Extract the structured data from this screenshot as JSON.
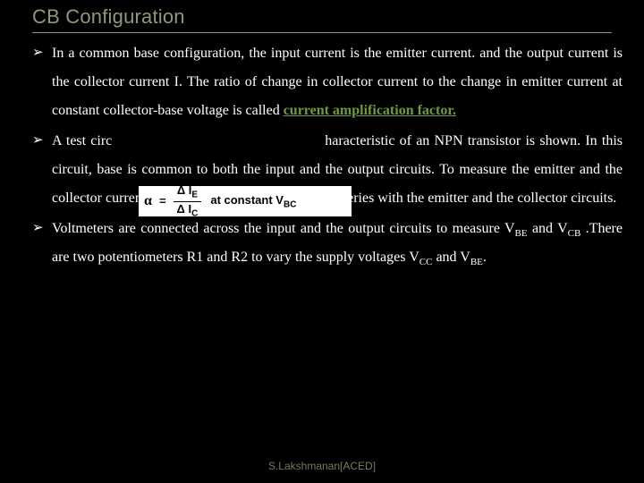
{
  "title": "CB Configuration",
  "bullets": {
    "b1_pre": "In a common base configuration, the input current is the emitter current. and the output current is the collector current I. The ratio of change in collector current to the change in emitter current at constant collector-base voltage is called ",
    "b1_hl": "current amplification factor.",
    "b2_pre": "A test circ",
    "b2_post": "haracteristic of an NPN transistor is shown. In this circuit, base is common to both the input and the output circuits. To measure the emitter and the collector currents mull ammeters are connected in series with the emitter and the collector circuits.",
    "b3_a": "Voltmeters are connected across the input and the output circuits to measure V",
    "b3_sub1": "BE",
    "b3_b": " and V",
    "b3_sub2": "CB",
    "b3_c": " .There are two potentiometers R1 and R2 to vary the supply voltages V",
    "b3_sub3": "CC",
    "b3_d": " and V",
    "b3_sub4": "BE",
    "b3_e": "."
  },
  "formula": {
    "alpha": "α",
    "eq": "=",
    "num_pre": "Δ I",
    "num_sub": "E",
    "den_pre": "Δ I",
    "den_sub": "C",
    "rest_pre": "at constant  V",
    "rest_sub": "BC"
  },
  "footer": "S.Lakshmanan[ACED]"
}
